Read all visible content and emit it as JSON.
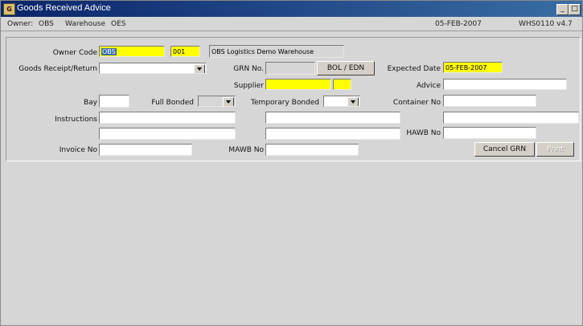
{
  "window": {
    "title": "Goods Received Advice",
    "icon_label": "G"
  },
  "infobar": {
    "owner_label": "Owner:",
    "owner_value": "OBS",
    "warehouse_label": "Warehouse",
    "warehouse_value": "OES",
    "date": "05-FEB-2007",
    "module": "WHS0110  v4.7"
  },
  "form": {
    "owner_code_label": "Owner Code",
    "owner_code": "OBS",
    "warehouse_code": "001",
    "warehouse_name": "OBS Logistics Demo Warehouse",
    "goods_receipt_label": "Goods Receipt/Return",
    "goods_receipt_value": "",
    "grn_label": "GRN No.",
    "grn_value": "",
    "bol_button": "BOL / EDN",
    "expected_date_label": "Expected Date",
    "expected_date": "05-FEB-2007",
    "supplier_label": "Supplier",
    "supplier_value": "",
    "supplier_code": "",
    "advice_label": "Advice",
    "advice_value": "",
    "bay_label": "Bay",
    "bay_value": "",
    "full_bonded_label": "Full Bonded",
    "full_bonded_value": "",
    "temporary_bonded_label": "Temporary Bonded",
    "temporary_bonded_value": "",
    "container_label": "Container No",
    "container_value": "",
    "instructions_label": "Instructions",
    "instructions_1": "",
    "instructions_2": "",
    "instructions_3": "",
    "instructions_4": "",
    "extra_right": "",
    "hawb_label": "HAWB No",
    "hawb_value": "",
    "invoice_label": "Invoice No",
    "invoice_value": "",
    "mawb_label": "MAWB No",
    "mawb_value": "",
    "cancel_button": "Cancel GRN",
    "print_button": "Print"
  }
}
